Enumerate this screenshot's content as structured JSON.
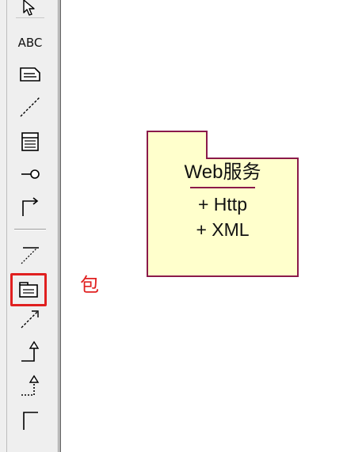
{
  "palette": {
    "tools": [
      {
        "name": "select",
        "icon": "pointer-arrow-icon"
      },
      {
        "name": "text",
        "label": "ABC"
      },
      {
        "name": "note",
        "icon": "note-icon"
      },
      {
        "name": "line",
        "icon": "dashed-line-icon"
      },
      {
        "name": "class",
        "icon": "class-icon"
      },
      {
        "name": "interface",
        "icon": "lollipop-interface-icon"
      },
      {
        "name": "association",
        "icon": "bent-arrow-icon"
      },
      {
        "name": "dependency-line",
        "icon": "line-with-tick-icon"
      },
      {
        "name": "package",
        "icon": "package-icon",
        "highlighted": true
      },
      {
        "name": "dependency",
        "icon": "dashed-arrow-icon"
      },
      {
        "name": "generalization",
        "icon": "generalization-arrow-icon"
      },
      {
        "name": "realization",
        "icon": "dashed-generalization-arrow-icon"
      },
      {
        "name": "anchor",
        "icon": "corner-line-icon"
      }
    ],
    "highlight_color": "#e02020"
  },
  "annotation": {
    "label": "包",
    "color": "#e02020"
  },
  "diagram": {
    "package": {
      "name": "Web服务",
      "members": [
        "+ Http",
        "+ XML"
      ],
      "fill_color": "#ffffcc",
      "border_color": "#8b1a4a"
    }
  }
}
